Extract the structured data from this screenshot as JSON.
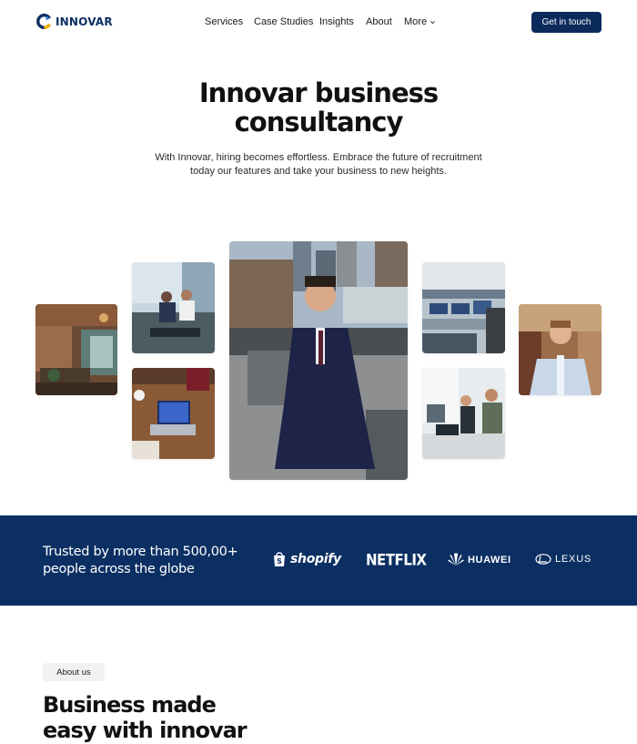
{
  "brand": {
    "name": "INNOVAR"
  },
  "nav": {
    "links": [
      "Services",
      "Case Studies",
      "Insights",
      "About",
      "More"
    ],
    "cta": "Get in touch"
  },
  "hero": {
    "title_line1": "Innovar business",
    "title_line2": "consultancy",
    "subtitle_line1": "With Innovar, hiring becomes effortless. Embrace the future of recruitment",
    "subtitle_line2": "today our features and take your business to new heights."
  },
  "trust": {
    "line1": "Trusted by more than 500,00+",
    "line2": "people across the globe",
    "logos": [
      "shopify",
      "NETFLIX",
      "HUAWEI",
      "LEXUS"
    ]
  },
  "about": {
    "pill": "About us",
    "title_line1": "Business made",
    "title_line2": "easy with innovar"
  },
  "colors": {
    "primary": "#0b2f63",
    "button": "#0b2a5c",
    "pill_bg": "#f1f1f1"
  },
  "icons": [
    "innovar-logo-icon",
    "chevron-down-icon",
    "shopify-bag-icon",
    "huawei-petal-icon",
    "lexus-emblem-icon"
  ]
}
